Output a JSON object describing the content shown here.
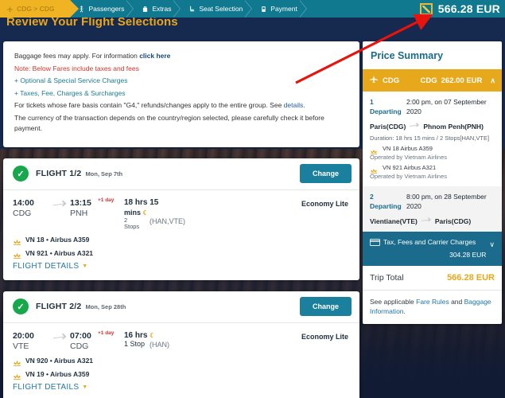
{
  "header": {
    "steps": [
      {
        "label": "CDG > CDG",
        "icon": "airplane-icon",
        "active": true
      },
      {
        "label": "Passengers",
        "icon": "passenger-icon",
        "active": false
      },
      {
        "label": "Extras",
        "icon": "bag-icon",
        "active": false
      },
      {
        "label": "Seat Selection",
        "icon": "seat-icon",
        "active": false
      },
      {
        "label": "Payment",
        "icon": "payment-icon",
        "active": false
      }
    ],
    "total_price": "566.28 EUR"
  },
  "page_title": "Review Your Flight Selections",
  "notice": {
    "line1_text": "Baggage fees may apply. For information ",
    "line1_link": "click here",
    "line2": "Note: Below Fares include taxes and fees",
    "line3": "+ Optional & Special Service Charges",
    "line4": "+ Taxes, Fee, Charges & Surcharges",
    "line5_text": "For tickets whose fare basis contain \"G4,\" refunds/changes apply to the entire group. See ",
    "line5_link": "details.",
    "line6": "The currency of the transaction depends on the country/region selected, please carefully check it before payment."
  },
  "flights": [
    {
      "title": "FLIGHT 1/2",
      "date": "Mon, Sep 7th",
      "change_label": "Change",
      "depart_time": "14:00",
      "depart_code": "CDG",
      "arrive_time": "13:15",
      "arrive_code": "PNH",
      "plus_day": "+1 day",
      "duration_line1": "18 hrs 15",
      "duration_line2": "mins",
      "stops_count": "2",
      "stops_word": "Stops",
      "stops_codes": "(HAN,VTE)",
      "cabin": "Economy Lite",
      "segments": [
        {
          "text": "VN 18 • Airbus A359"
        },
        {
          "text": "VN 921 • Airbus A321"
        }
      ],
      "details_label": "FLIGHT DETAILS"
    },
    {
      "title": "FLIGHT 2/2",
      "date": "Mon, Sep 28th",
      "change_label": "Change",
      "depart_time": "20:00",
      "depart_code": "VTE",
      "arrive_time": "07:00",
      "arrive_code": "CDG",
      "plus_day": "+1 day",
      "duration_line1": "16 hrs",
      "duration_line2": "",
      "stops_count": "1 Stop",
      "stops_word": "",
      "stops_codes": "(HAN)",
      "cabin": "Economy Lite",
      "segments": [
        {
          "text": "VN 920 • Airbus A321"
        },
        {
          "text": "VN 19 • Airbus A359"
        }
      ],
      "details_label": "FLIGHT DETAILS"
    }
  ],
  "price_summary": {
    "title": "Price Summary",
    "fare_bar": {
      "from": "CDG",
      "to": "CDG",
      "amount": "262.00 EUR",
      "chevron": "∧"
    },
    "segments": [
      {
        "index": "1",
        "departing_label": "Departing",
        "time_date": "2:00 pm, on 07 September",
        "year": "2020",
        "origin": "Paris(CDG)",
        "destination": "Phnom Penh(PNH)",
        "duration": "Duration: 18 hrs 15 mins / 2 Stops[HAN,VTE]",
        "legs": [
          {
            "flight": "VN 18 Airbus A359",
            "operated": "Operated by Vietnam Airlines"
          },
          {
            "flight": "VN 921 Airbus A321",
            "operated": "Operated by Vietnam Airlines"
          }
        ]
      },
      {
        "index": "2",
        "departing_label": "Departing",
        "time_date": "8:00 pm, on 28 September",
        "year": "2020",
        "origin": "Vientiane(VTE)",
        "destination": "Paris(CDG)",
        "duration": "",
        "legs": []
      }
    ],
    "tax": {
      "label": "Tax, Fees and Carrier Charges",
      "amount": "304.28 EUR",
      "chevron": "∨"
    },
    "trip_total_label": "Trip Total",
    "trip_total_value": "566.28 EUR",
    "footer_pre": "See applicable ",
    "footer_link1": "Fare Rules",
    "footer_mid": " and ",
    "footer_link2": "Baggage Information",
    "footer_post": "."
  },
  "colors": {
    "teal": "#10798f",
    "gold": "#e8a81b",
    "navy": "#16294e",
    "green": "#17a84b",
    "link_blue": "#2176a8",
    "red": "#d0342c"
  }
}
